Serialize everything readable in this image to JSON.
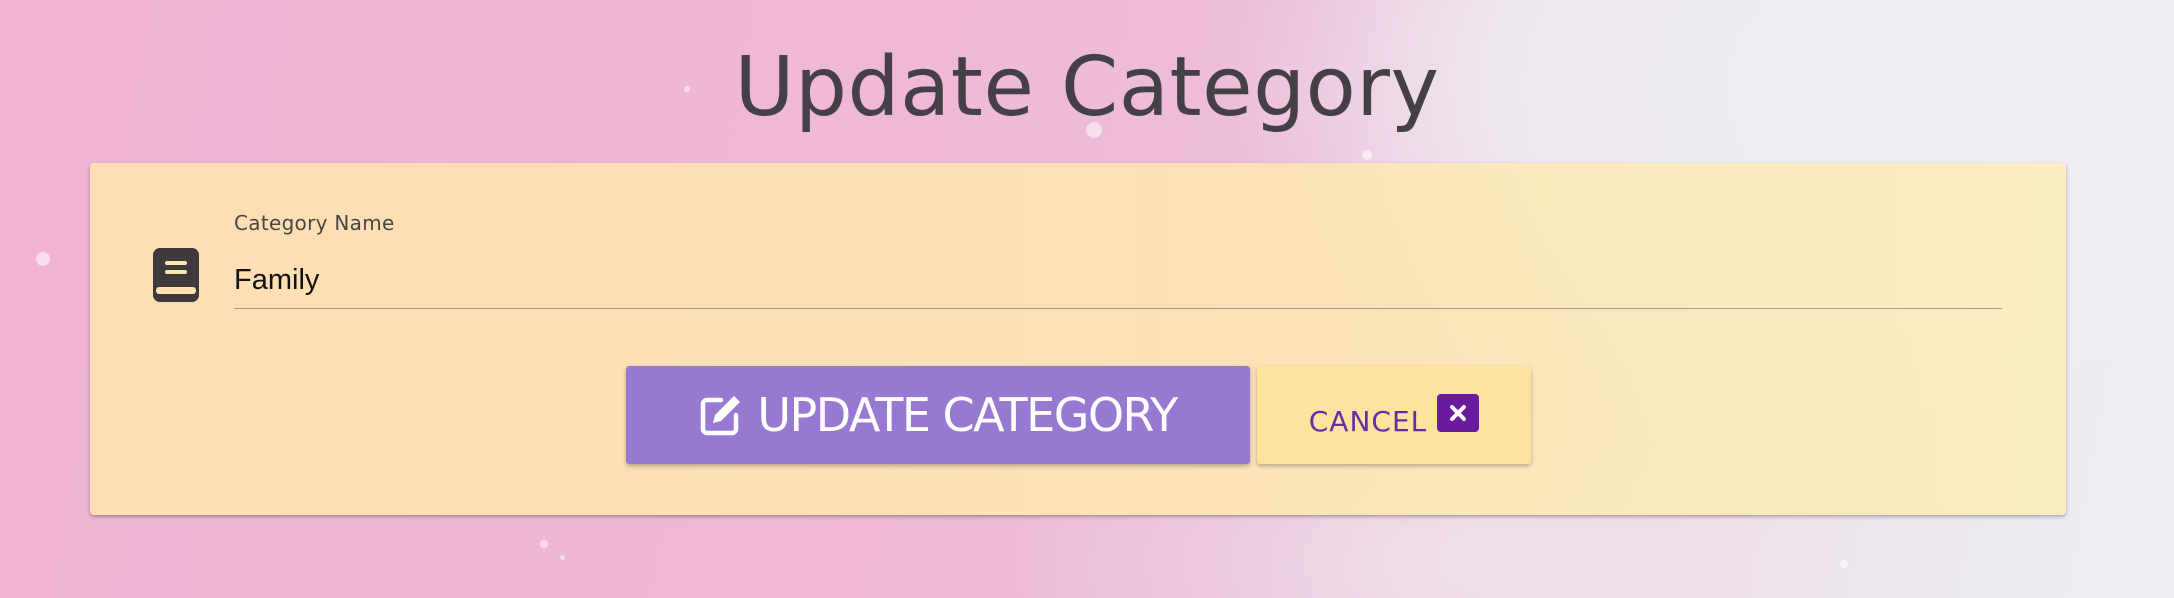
{
  "header": {
    "title": "Update Category"
  },
  "form": {
    "field_label": "Category Name",
    "field_value": "Family",
    "field_icon": "book-icon"
  },
  "actions": {
    "update_label": "UPDATE CATEGORY",
    "update_icon": "edit-icon",
    "cancel_label": "CANCEL",
    "cancel_icon": "close-icon"
  },
  "colors": {
    "update_button_bg": "#9879d2",
    "cancel_button_bg": "#fde39d",
    "cancel_text": "#6a2ca6",
    "card_bg": "#fde3b2"
  }
}
